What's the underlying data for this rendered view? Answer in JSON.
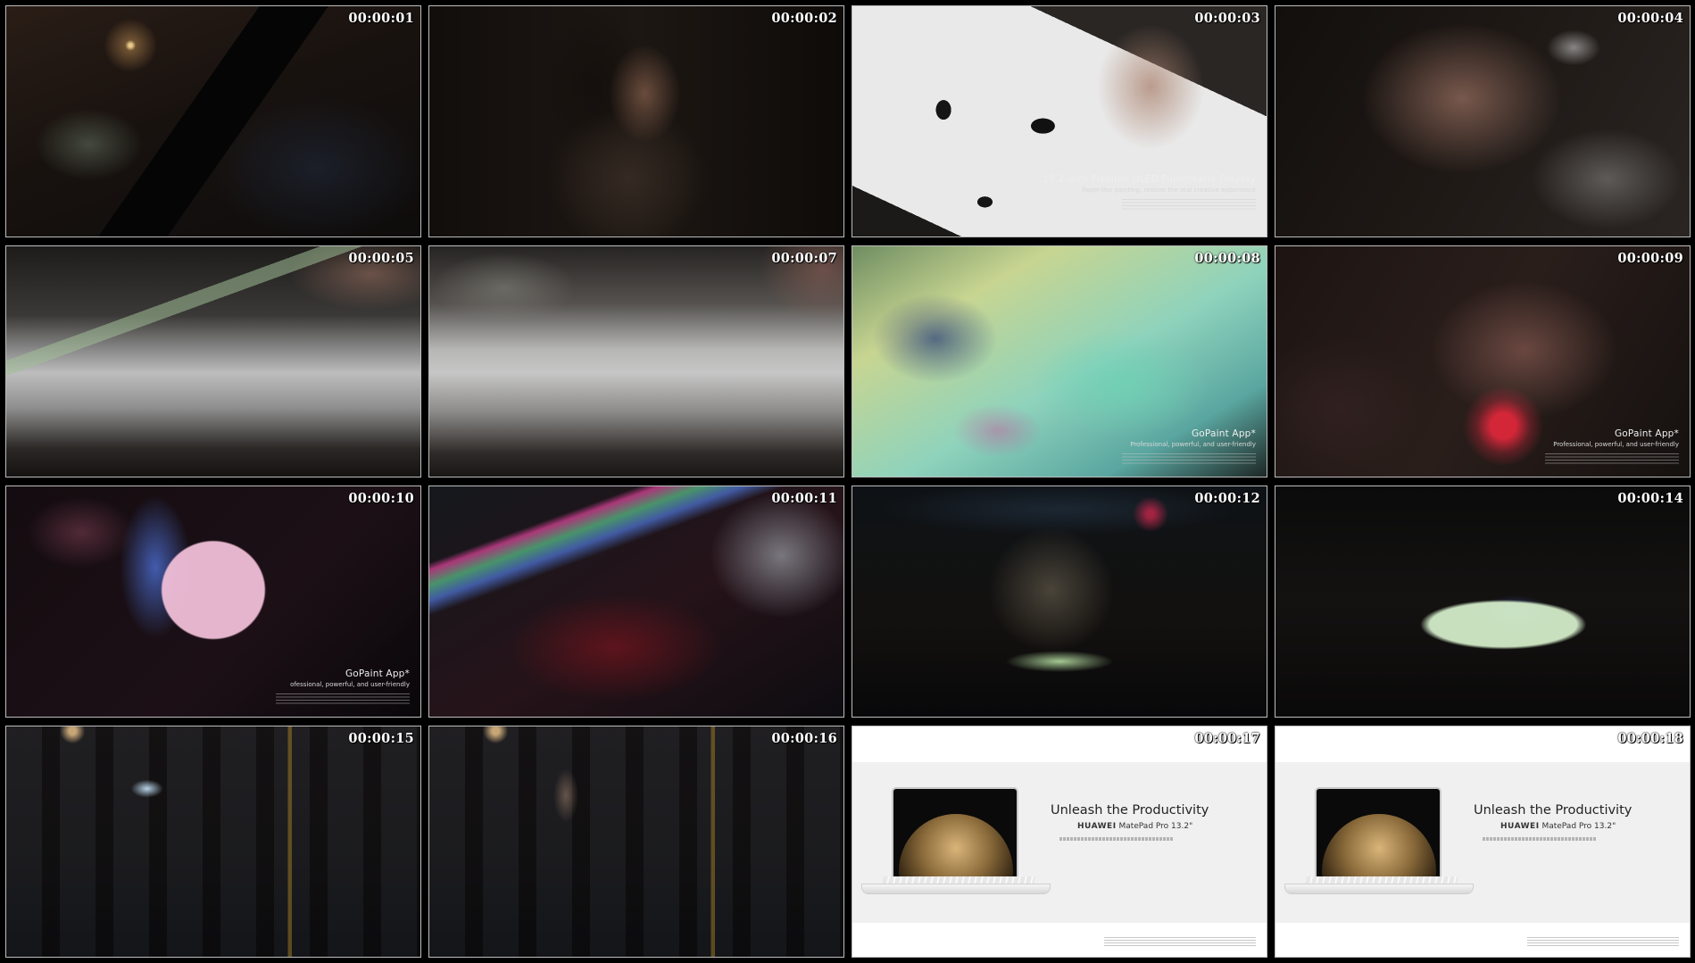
{
  "frames": [
    {
      "timestamp": "00:00:01"
    },
    {
      "timestamp": "00:00:02"
    },
    {
      "timestamp": "00:00:03",
      "caption": {
        "heading": "13.2-inch Flexible OLED PaperMatte Display",
        "sub": "Paper-like painting, restore the real creative experience"
      }
    },
    {
      "timestamp": "00:00:04"
    },
    {
      "timestamp": "00:00:05"
    },
    {
      "timestamp": "00:00:07"
    },
    {
      "timestamp": "00:00:08",
      "caption": {
        "heading": "GoPaint App*",
        "sub": "Professional, powerful, and user-friendly"
      }
    },
    {
      "timestamp": "00:00:09",
      "caption": {
        "heading": "GoPaint App*",
        "sub": "Professional, powerful, and user-friendly"
      }
    },
    {
      "timestamp": "00:00:10",
      "caption": {
        "heading": "GoPaint App*",
        "sub": "ofessional, powerful, and user-friendly"
      }
    },
    {
      "timestamp": "00:00:11"
    },
    {
      "timestamp": "00:00:12"
    },
    {
      "timestamp": "00:00:14"
    },
    {
      "timestamp": "00:00:15"
    },
    {
      "timestamp": "00:00:16"
    },
    {
      "timestamp": "00:00:17",
      "product": {
        "title": "Unleash the Productivity",
        "brand": "HUAWEI",
        "model": "MatePad Pro 13.2\""
      }
    },
    {
      "timestamp": "00:00:18",
      "product": {
        "title": "Unleash the Productivity",
        "brand": "HUAWEI",
        "model": "MatePad Pro 13.2\""
      }
    }
  ]
}
